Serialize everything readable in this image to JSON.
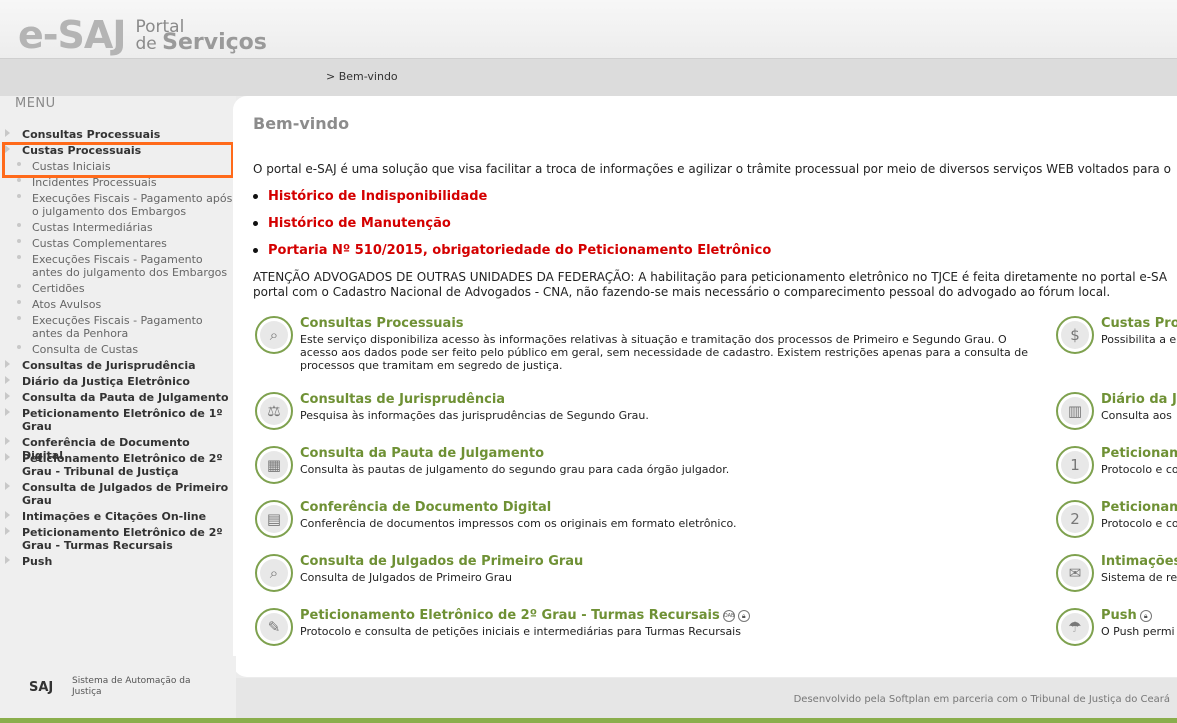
{
  "header": {
    "logo_text": "e-SAJ",
    "portal_line1": "Portal",
    "portal_line2_prefix": "de ",
    "portal_line2": "Serviços",
    "breadcrumb": "> Bem-vindo"
  },
  "sidebar": {
    "menu_title": "MENU",
    "items": [
      {
        "label": "Consultas Processuais"
      },
      {
        "label": "Custas Processuais"
      },
      {
        "label": "Consultas de Jurisprudência"
      },
      {
        "label": "Diário da Justiça Eletrônico"
      },
      {
        "label": "Consulta da Pauta de Julgamento"
      },
      {
        "label": "Peticionamento Eletrônico de 1º Grau"
      },
      {
        "label": "Conferência de Documento Digital"
      },
      {
        "label": "Peticionamento Eletrônico de 2º Grau - Tribunal de Justiça"
      },
      {
        "label": "Consulta de Julgados de Primeiro Grau"
      },
      {
        "label": "Intimações e Citações On-line"
      },
      {
        "label": "Peticionamento Eletrônico de 2º Grau - Turmas Recursais"
      },
      {
        "label": "Push"
      }
    ],
    "subitems": [
      {
        "label": "Custas Iniciais"
      },
      {
        "label": "Incidentes Processuais"
      },
      {
        "label": "Execuções Fiscais - Pagamento após o julgamento dos Embargos"
      },
      {
        "label": "Custas Intermediárias"
      },
      {
        "label": "Custas Complementares"
      },
      {
        "label": "Execuções Fiscais - Pagamento antes do julgamento dos Embargos"
      },
      {
        "label": "Certidões"
      },
      {
        "label": "Atos Avulsos"
      },
      {
        "label": "Execuções Fiscais - Pagamento antes da Penhora"
      },
      {
        "label": "Consulta de Custas"
      }
    ]
  },
  "main": {
    "title": "Bem-vindo",
    "intro": "O portal e-SAJ é uma solução que visa facilitar a troca de informações e agilizar o trâmite processual por meio de diversos serviços WEB voltados para o",
    "links": [
      {
        "label": "Histórico de Indisponibilidade"
      },
      {
        "label": "Histórico de Manutenção"
      },
      {
        "label": "Portaria Nº 510/2015, obrigatoriedade do Peticionamento Eletrônico"
      }
    ],
    "attention_line1": "ATENÇÃO ADVOGADOS DE OUTRAS UNIDADES DA FEDERAÇÃO: A habilitação para peticionamento eletrônico no TJCE é feita diretamente no portal e-SA",
    "attention_line2": "portal com o Cadastro Nacional de Advogados - CNA, não fazendo-se mais necessário o comparecimento pessoal do advogado ao fórum local.",
    "services_left": [
      {
        "title": "Consultas Processuais",
        "desc": "Este serviço disponibiliza acesso às informações relativas à situação e tramitação dos processos de Primeiro e Segundo Grau. O acesso aos dados pode ser feito pelo público em geral, sem necessidade de cadastro. Existem restrições apenas para a consulta de processos que tramitam em segredo de justiça.",
        "icon": "magnifier-icon"
      },
      {
        "title": "Consultas de Jurisprudência",
        "desc": "Pesquisa às informações das jurisprudências de Segundo Grau.",
        "icon": "jurisprudence-search-icon"
      },
      {
        "title": "Consulta da Pauta de Julgamento",
        "desc": "Consulta às pautas de julgamento do segundo grau para cada órgão julgador.",
        "icon": "calendar-search-icon"
      },
      {
        "title": "Conferência de Documento Digital",
        "desc": "Conferência de documentos impressos com os originais em formato eletrônico.",
        "icon": "document-icon"
      },
      {
        "title": "Consulta de Julgados de Primeiro Grau",
        "desc": "Consulta de Julgados de Primeiro Grau",
        "icon": "gavel-search-icon"
      },
      {
        "title": "Peticionamento Eletrônico de 2º Grau - Turmas Recursais",
        "desc": "Protocolo e consulta de petições iniciais e intermediárias para Turmas Recursais",
        "icon": "petition-icon",
        "badges": [
          "OAB",
          "lock"
        ]
      }
    ],
    "services_right": [
      {
        "title": "Custas Pro",
        "desc": "Possibilita a e",
        "icon": "money-icon"
      },
      {
        "title": "Diário da J",
        "desc": "Consulta aos",
        "icon": "book-icon"
      },
      {
        "title": "Peticionam",
        "desc": "Protocolo e co",
        "icon": "petition-1-icon"
      },
      {
        "title": "Peticionam",
        "desc": "Protocolo e co",
        "icon": "petition-2-icon"
      },
      {
        "title": "Intimações",
        "desc": "Sistema de re",
        "icon": "notification-icon"
      },
      {
        "title": "Push",
        "desc": "O Push permi",
        "icon": "parachute-icon",
        "badges": [
          "lock"
        ]
      }
    ]
  },
  "footer": {
    "saj_logo": "SAJ",
    "saj_text": "Sistema de Automação da Justiça",
    "credits": "Desenvolvido pela Softplan em parceria com o Tribunal de Justiça do Ceará"
  },
  "colors": {
    "accent_green": "#6f9135",
    "link_red": "#d40000",
    "highlight_orange": "#ff6a1a"
  }
}
